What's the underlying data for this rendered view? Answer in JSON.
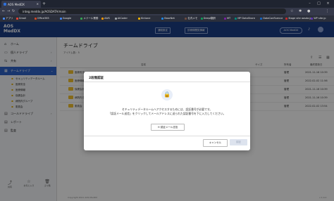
{
  "browser": {
    "tab_title": "AOS MedDX",
    "url": "integ.meddx.jp/AOSDATA/main",
    "bookmarks": [
      "アプリ",
      "Gmail",
      "Office365",
      "Google",
      "メドール業務",
      "AWS",
      "AtCoder",
      "Kintone",
      "BaseNet",
      "社内メモ",
      "Deepl翻訳",
      "MT",
      "MP DataShare",
      "DataConfluence",
      "Stage site aosda.jp",
      "WP site.jp",
      "ナレッジ"
    ]
  },
  "header": {
    "logo_line1": "AOS",
    "logo_line2": "MedDX",
    "btn_notice": "通知設定",
    "btn_login_history": "診療録閲覧情報",
    "org": "AOS MedDX"
  },
  "sidebar": {
    "items": [
      {
        "icon": "⌂",
        "label": "ホーム"
      },
      {
        "icon": "▭",
        "label": "個人ドライブ"
      },
      {
        "icon": "⇆",
        "label": "共有"
      },
      {
        "icon": "▦",
        "label": "チームドライブ"
      }
    ],
    "subitems": [
      "セキュリティデータルーム",
      "医療安全",
      "医療情報",
      "保健会計",
      "病院内グループ",
      "委員会"
    ],
    "extra": [
      {
        "icon": "▤",
        "label": "コールドドライブ"
      },
      {
        "icon": "▤",
        "label": "レポート"
      },
      {
        "icon": "▤",
        "label": "監査"
      }
    ],
    "bottom": [
      {
        "icon": "⤴",
        "label": "共有"
      },
      {
        "icon": "☆",
        "label": "お気に入り"
      },
      {
        "icon": "🗑",
        "label": "ゴミ箱"
      }
    ],
    "copyright": "Copyright 2021 AOS MedDX",
    "version": "v 1.0.0"
  },
  "main": {
    "title": "チームドライブ",
    "item_count": "アイテム数：5",
    "columns": [
      "名前",
      "サイズ",
      "所有者",
      "最終更新日"
    ],
    "rows": [
      {
        "name": "医療安全",
        "owner": "管理",
        "date": "2021-11-16 10:39"
      },
      {
        "name": "医療情報",
        "owner": "管理",
        "date": "2022-02-02 11:56"
      },
      {
        "name": "保健会計",
        "owner": "管理",
        "date": "2021-11-16 10:39"
      },
      {
        "name": "病院内グループ",
        "owner": "管理",
        "date": "2021-11-16 10:39"
      },
      {
        "name": "委員会",
        "owner": "管理",
        "date": "2022-02-02 13:54"
      }
    ]
  },
  "modal": {
    "title": "2段階認証",
    "line1": "セキュリティデータルームへアクセスするためには、認証番号が必要です。",
    "line2": "「認証メール送信」をクリックしてメールアドレスに送られた認証番号を下に入力してください。",
    "send_button": "認証メール送信",
    "cancel_button": "キャンセル",
    "ok_button": "認証"
  }
}
